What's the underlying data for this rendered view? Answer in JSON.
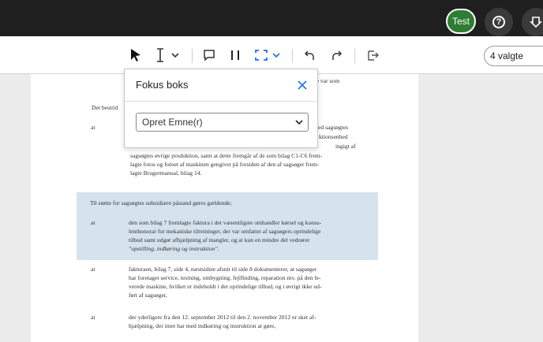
{
  "topbar": {
    "test_label": "Test",
    "help_icon": "question-icon",
    "help_glyph": "?",
    "download_icon": "download-icon"
  },
  "toolbar": {
    "tools": [
      "arrow-cursor-icon",
      "text-cursor-icon",
      "chevron-down-icon",
      "comment-icon",
      "columns-icon",
      "selection-box-icon",
      "chevron-down-icon",
      "undo-icon",
      "redo-icon",
      "export-icon"
    ],
    "selection_value": "4 valgte"
  },
  "popup": {
    "title": "Fokus boks",
    "select_value": "Opret Emne(r)"
  },
  "document": {
    "frag_top_right": "kke var som",
    "frag_left": "Det bestrid",
    "at_1": "at",
    "frag_right_1": "ed sagsøgtes",
    "frag_right_2": "ktionsenhed",
    "frag_right_3": "ingigt af",
    "p1_line1": "sagsøgtes øvrige produktion, samt at dette fremgår af de som bilag C1-C6 frem-",
    "p1_line2": "lagte fotos og fotoet af maskinen gengivet på forsiden af den af sagsøger frem-",
    "p1_line3": "lagte Brugermanual, bilag 14.",
    "intro": "Til støtte for sagsøgtes subsidiære påstand gøres gældende;",
    "at_2": "at",
    "p2_line1": "den som bilag 7 fremlagte faktura i det væsentligste omhandler kørsel og konsu-",
    "p2_line2": "lenthonorar for mekaniske tilretninger, der var omfattet af sagsøgers oprindelige",
    "p2_line3": "tilbud samt udgør afhjælpning af mangler, og at kun en mindre del vedrører",
    "p2_line4": "\"opstilling, indkøring og instruktion\".",
    "at_3": "at",
    "p3_line1": "fakturaen, bilag 7, side 4, næstsidste afsnit til side 8 dokumenterer, at sagsøger",
    "p3_line2": "har foretaget service, testning, ombygning, fejlfinding, reparation mv. på den le-",
    "p3_line3": "verede maskine, hvilket er indeholdt i det oprindelige tilbud, og i øvrigt ikke ud-",
    "p3_line4": "ført af sagsøger,",
    "at_4": "at",
    "p4_line1": "der yderligere fra den 12. september 2012 til den 2. november 2012 er sket af-",
    "p4_line2": "hjælpning, der intet har med indkøring og instruktion at gøre,"
  },
  "colors": {
    "topbar": "#1f1f1f",
    "accent_green": "#2e7d32",
    "highlight": "#d5e3ee",
    "primary_blue": "#1a73e8"
  }
}
